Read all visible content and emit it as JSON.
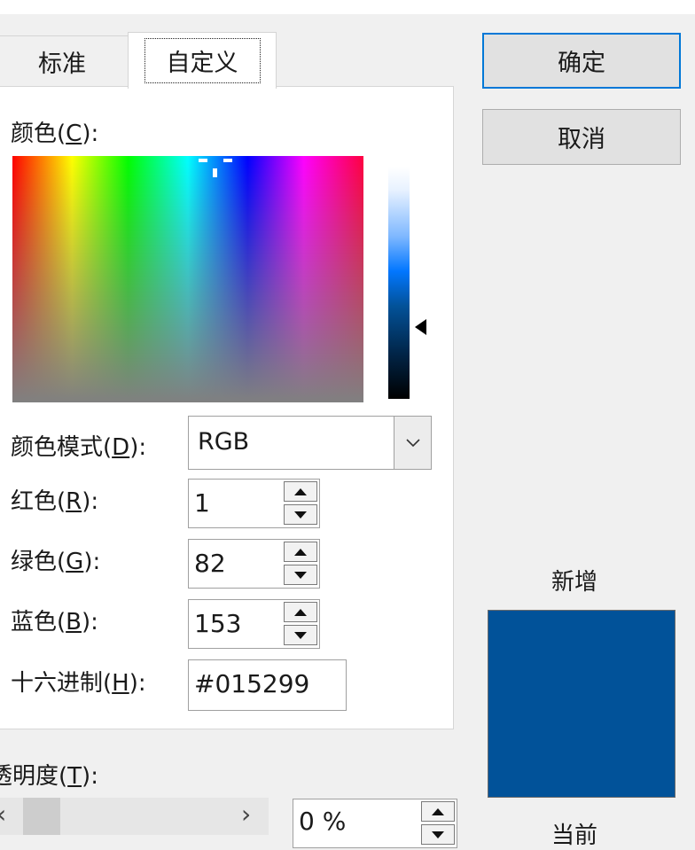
{
  "tabs": [
    {
      "label": "标准"
    },
    {
      "label": "自定义"
    }
  ],
  "labels": {
    "colors_main": "颜色(",
    "colors_key": "C",
    "colors_end": "):",
    "mode_main": "颜色模式(",
    "mode_key": "D",
    "mode_end": "):",
    "red_main": "红色(",
    "red_key": "R",
    "red_end": "):",
    "green_main": "绿色(",
    "green_key": "G",
    "green_end": "):",
    "blue_main": "蓝色(",
    "blue_key": "B",
    "blue_end": "):",
    "hex_main": "十六进制(",
    "hex_key": "H",
    "hex_end": "):",
    "transparency_main": "透明度(",
    "transparency_key": "T",
    "transparency_end": "):"
  },
  "color_mode": {
    "selected": "RGB"
  },
  "rgb": {
    "red": "1",
    "green": "82",
    "blue": "153"
  },
  "hex": {
    "value": "#015299"
  },
  "transparency": {
    "value": "0 %",
    "scroll_fraction": 0
  },
  "buttons": {
    "ok": "确定",
    "cancel": "取消"
  },
  "swatch": {
    "new_label": "新增",
    "current_label": "当前",
    "new_color": "#015299"
  },
  "icons": {
    "dropdown": "chevron-down-icon",
    "spin_up": "triangle-up-icon",
    "spin_down": "triangle-down-icon",
    "scroll_left": "chevron-left-icon",
    "scroll_right": "chevron-right-icon",
    "luminance_pointer": "triangle-left-icon"
  }
}
